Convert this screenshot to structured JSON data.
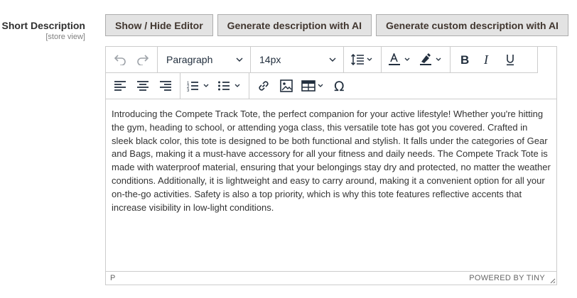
{
  "field": {
    "label": "Short Description",
    "scope": "[store view]"
  },
  "buttons": {
    "toggle_editor": "Show / Hide Editor",
    "generate_ai": "Generate description with AI",
    "generate_custom_ai": "Generate custom description with AI"
  },
  "toolbar": {
    "block_format": "Paragraph",
    "font_size": "14px",
    "icons": [
      "undo-icon",
      "redo-icon",
      "line-height-icon",
      "text-color-icon",
      "highlight-color-icon",
      "bold-icon",
      "italic-icon",
      "underline-icon",
      "align-left-icon",
      "align-center-icon",
      "align-right-icon",
      "numbered-list-icon",
      "bullet-list-icon",
      "link-icon",
      "image-icon",
      "table-icon",
      "special-character-icon"
    ],
    "text_color": "#222f3e",
    "highlight_color": "#222f3e"
  },
  "content": {
    "text": "Introducing the Compete Track Tote, the perfect companion for your active lifestyle! Whether you're hitting the gym, heading to school, or attending yoga class, this versatile tote has got you covered. Crafted in sleek black color, this tote is designed to be both functional and stylish. It falls under the categories of Gear and Bags, making it a must-have accessory for all your fitness and daily needs. The Compete Track Tote is made with waterproof material, ensuring that your belongings stay dry and protected, no matter the weather conditions. Additionally, it is lightweight and easy to carry around, making it a convenient option for all your on-the-go activities. Safety is also a top priority, which is why this tote features reflective accents that increase visibility in low-light conditions."
  },
  "statusbar": {
    "path": "P",
    "branding": "POWERED BY TINY"
  }
}
